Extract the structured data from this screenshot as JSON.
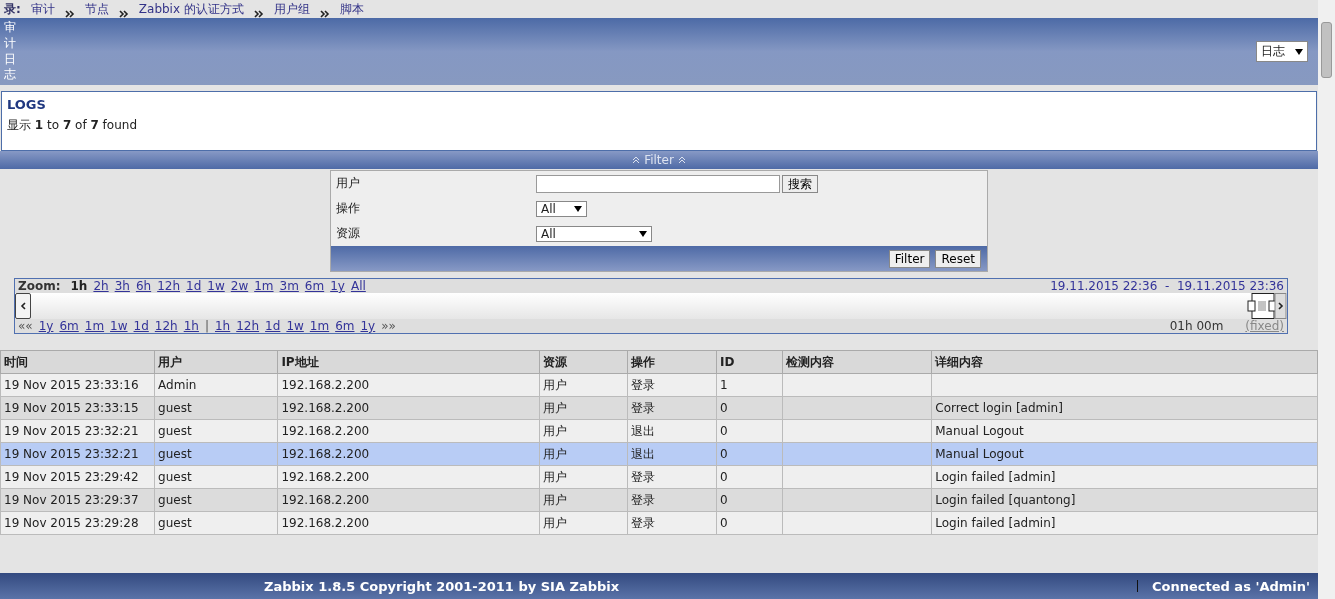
{
  "breadcrumb": {
    "label": "录:",
    "items": [
      "审计",
      "节点",
      "Zabbix 的认证方式",
      "用户组",
      "脚本"
    ]
  },
  "header": {
    "title": "审计日志",
    "select": "日志"
  },
  "logs": {
    "title": "LOGS",
    "summary": "显示 **1** to **7** of **7** found"
  },
  "filter": {
    "toggle": "Filter",
    "fields": [
      {
        "kind": "text",
        "label": "用户",
        "button": "搜索"
      },
      {
        "kind": "select",
        "label": "操作",
        "value": "All"
      },
      {
        "kind": "select",
        "label": "资源",
        "value": "All"
      }
    ],
    "buttons": [
      "Filter",
      "Reset"
    ]
  },
  "zoom": {
    "label": "Zoom:",
    "periods": [
      {
        "label": "1h",
        "selected": true
      },
      {
        "label": "2h",
        "selected": false
      },
      {
        "label": "3h",
        "selected": false
      },
      {
        "label": "6h",
        "selected": false
      },
      {
        "label": "12h",
        "selected": false
      },
      {
        "label": "1d",
        "selected": false
      },
      {
        "label": "1w",
        "selected": false
      },
      {
        "label": "2w",
        "selected": false
      },
      {
        "label": "1m",
        "selected": false
      },
      {
        "label": "3m",
        "selected": false
      },
      {
        "label": "6m",
        "selected": false
      },
      {
        "label": "1y",
        "selected": false
      },
      {
        "label": "All",
        "selected": false
      }
    ],
    "from": "19.11.2015 22:36",
    "separator": "-",
    "to": "19.11.2015 23:36",
    "back_all": "««",
    "back": [
      "1y",
      "6m",
      "1m",
      "1w",
      "1d",
      "12h",
      "1h"
    ],
    "divider": "|",
    "forward": [
      "1h",
      "12h",
      "1d",
      "1w",
      "1m",
      "6m",
      "1y"
    ],
    "forward_all": "»»",
    "duration": "01h 00m",
    "fixed": "(fixed)"
  },
  "table": {
    "columns": [
      "时间",
      "用户",
      "IP地址",
      "资源",
      "操作",
      "ID",
      "检测内容",
      "详细内容"
    ],
    "rows": [
      {
        "selected": false,
        "cells": [
          "19 Nov 2015 23:33:16",
          "Admin",
          "192.168.2.200",
          "用户",
          "登录",
          "1",
          "",
          ""
        ]
      },
      {
        "selected": false,
        "cells": [
          "19 Nov 2015 23:33:15",
          "guest",
          "192.168.2.200",
          "用户",
          "登录",
          "0",
          "",
          "Correct login [admin]"
        ]
      },
      {
        "selected": false,
        "cells": [
          "19 Nov 2015 23:32:21",
          "guest",
          "192.168.2.200",
          "用户",
          "退出",
          "0",
          "",
          "Manual Logout"
        ]
      },
      {
        "selected": true,
        "cells": [
          "19 Nov 2015 23:32:21",
          "guest",
          "192.168.2.200",
          "用户",
          "退出",
          "0",
          "",
          "Manual Logout"
        ]
      },
      {
        "selected": false,
        "cells": [
          "19 Nov 2015 23:29:42",
          "guest",
          "192.168.2.200",
          "用户",
          "登录",
          "0",
          "",
          "Login failed [admin]"
        ]
      },
      {
        "selected": false,
        "cells": [
          "19 Nov 2015 23:29:37",
          "guest",
          "192.168.2.200",
          "用户",
          "登录",
          "0",
          "",
          "Login failed [quantong]"
        ]
      },
      {
        "selected": false,
        "cells": [
          "19 Nov 2015 23:29:28",
          "guest",
          "192.168.2.200",
          "用户",
          "登录",
          "0",
          "",
          "Login failed [admin]"
        ]
      }
    ]
  },
  "footer": {
    "copyright": "Zabbix 1.8.5 Copyright 2001-2011 by SIA Zabbix",
    "connected": "Connected as 'Admin'"
  }
}
